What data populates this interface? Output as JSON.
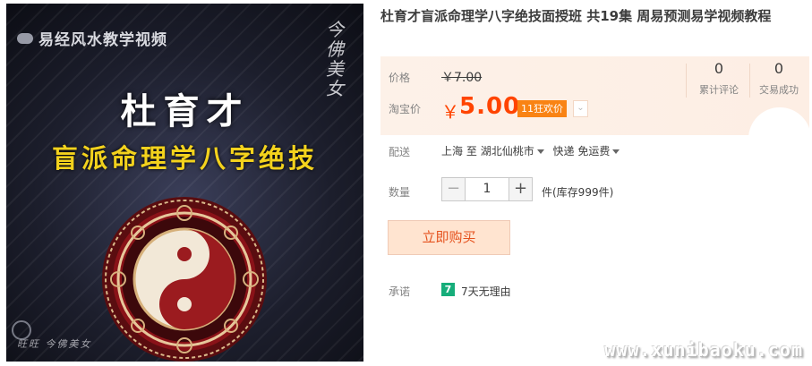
{
  "image": {
    "watermark": "易经风水教学视频",
    "seal_text": "今佛美女",
    "author": "杜育才",
    "course_title": "盲派命理学八字绝技",
    "bottom_sign": "旺旺 今佛美女"
  },
  "product": {
    "title": "杜育才盲派命理学八字绝技面授班 共19集 周易预测易学视频教程"
  },
  "price": {
    "price_label": "价格",
    "original_price": "￥7.00",
    "taobao_label": "淘宝价",
    "currency": "￥",
    "sale_price": "5.00",
    "discount_badge": "11狂欢价",
    "discount_dropdown": "⌄"
  },
  "stats": {
    "reviews_count": "0",
    "reviews_label": "累计评论",
    "sales_count": "0",
    "sales_label": "交易成功"
  },
  "shipping": {
    "label": "配送",
    "from": "上海",
    "to_word": "至",
    "destination": "湖北仙桃市",
    "method": "快递",
    "fee": "免运费"
  },
  "quantity": {
    "label": "数量",
    "minus": "−",
    "value": "1",
    "plus": "+",
    "stock": "件(库存999件)"
  },
  "buy_button": "立即购买",
  "promise": {
    "label": "承诺",
    "icon_text": "7",
    "text": "7天无理由"
  },
  "site_watermark": "www.xunibaoku.com",
  "colors": {
    "accent": "#ff4400",
    "badge": "#f98314",
    "price_panel_bg": "#fdf1e8",
    "buy_button_bg": "#ffe4d0",
    "promise_icon": "#16ad7a",
    "course_title": "#f3d21d"
  }
}
